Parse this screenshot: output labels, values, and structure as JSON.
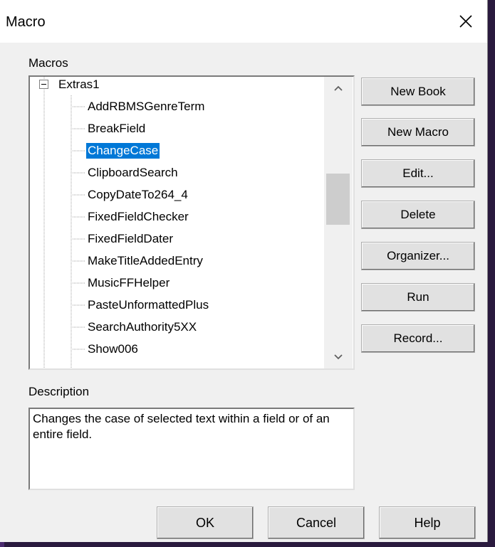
{
  "window": {
    "title": "Macro"
  },
  "macros_label": "Macros",
  "tree": {
    "root": "Extras1",
    "items": [
      "AddRBMSGenreTerm",
      "BreakField",
      "ChangeCase",
      "ClipboardSearch",
      "CopyDateTo264_4",
      "FixedFieldChecker",
      "FixedFieldDater",
      "MakeTitleAddedEntry",
      "MusicFFHelper",
      "PasteUnformattedPlus",
      "SearchAuthority5XX",
      "Show006"
    ],
    "selected": "ChangeCase"
  },
  "buttons": {
    "new_book": "New Book",
    "new_macro": "New Macro",
    "edit": "Edit...",
    "delete": "Delete",
    "organizer": "Organizer...",
    "run": "Run",
    "record": "Record..."
  },
  "description": {
    "label": "Description",
    "text": "Changes the case of selected text within a field or of an entire field."
  },
  "footer": {
    "ok": "OK",
    "cancel": "Cancel",
    "help": "Help"
  },
  "colors": {
    "selection": "#0078d7",
    "dialog_bg": "#f0f0f0",
    "backdrop": "#2a1a3e"
  }
}
